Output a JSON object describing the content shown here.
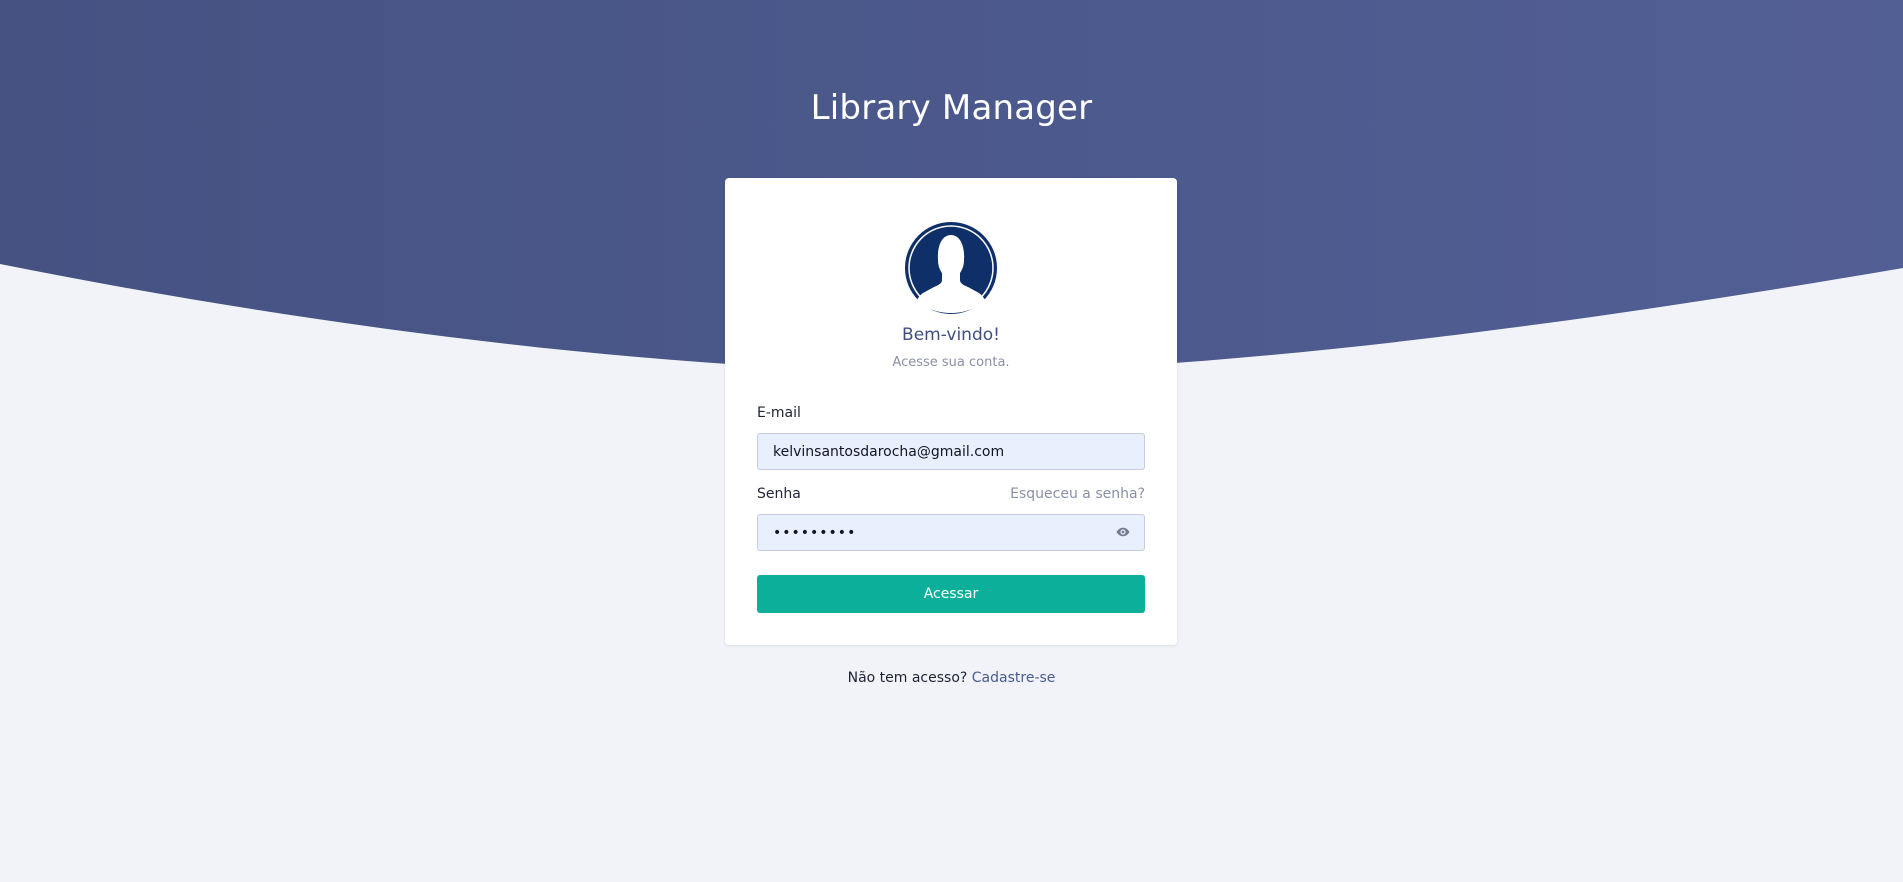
{
  "app": {
    "title": "Library Manager"
  },
  "login_card": {
    "welcome": "Bem-vindo!",
    "subtitle": "Acesse sua conta.",
    "email_label": "E-mail",
    "email_value": "kelvinsantosdarocha@gmail.com",
    "password_label": "Senha",
    "forgot_password_link": "Esqueceu a senha?",
    "password_value": "•••••••••",
    "submit_label": "Acessar",
    "avatar_icon": "user-silhouette-icon",
    "password_toggle_icon": "eye-icon"
  },
  "footer": {
    "prompt": "Não tem acesso? ",
    "signup_link": "Cadastre-se"
  },
  "colors": {
    "header_gradient_start": "#455282",
    "header_gradient_end": "#525f95",
    "page_background": "#f2f3f8",
    "primary_button": "#0cb09a",
    "avatar": "#0e2f68",
    "input_background": "#e8f0fe",
    "link": "#4a5b8f"
  }
}
